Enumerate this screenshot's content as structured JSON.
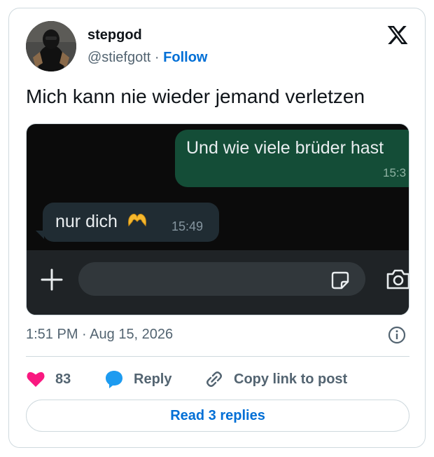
{
  "author": {
    "display_name": "stepgod",
    "handle": "@stiefgott",
    "separator": "·",
    "follow_label": "Follow"
  },
  "tweet": {
    "text": "Mich kann nie wieder jemand verletzen"
  },
  "media": {
    "outgoing": {
      "text": "Und wie viele brüder hast",
      "time": "15:3"
    },
    "incoming": {
      "text": "nur dich",
      "emoji": "heart-hands",
      "time": "15:49"
    },
    "icons": [
      "plus-icon",
      "sticker-icon",
      "camera-icon"
    ]
  },
  "meta": {
    "time": "1:51 PM",
    "separator": "·",
    "date": "Aug 15, 2026"
  },
  "actions": {
    "like_count": "83",
    "reply_label": "Reply",
    "copy_label": "Copy link to post"
  },
  "replies_button": "Read 3 replies",
  "colors": {
    "accent": "#006fd6",
    "like": "#f91880",
    "reply_icon": "#1d9bf0",
    "text_secondary": "#536471",
    "chat_outgoing": "#144d37",
    "chat_incoming": "#202c33"
  }
}
